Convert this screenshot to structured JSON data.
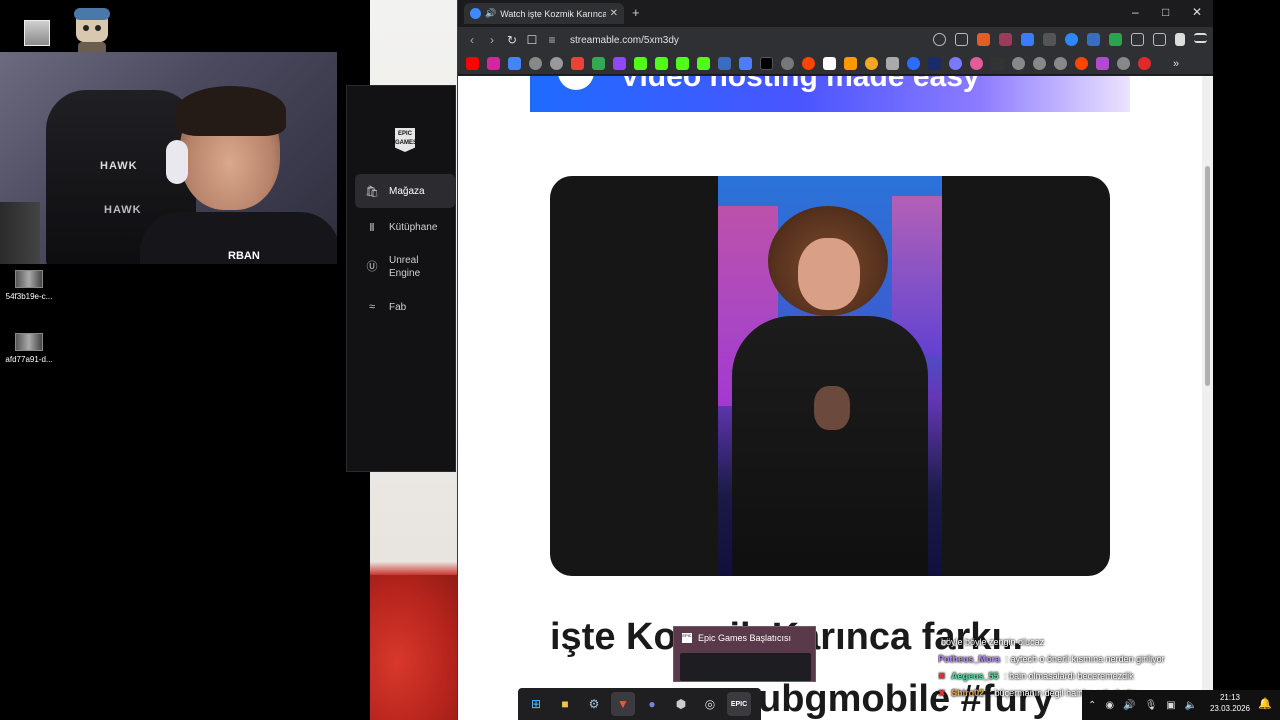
{
  "desktop": {
    "icons": [
      {
        "label": "54f3b19e-c..."
      },
      {
        "label": "afd77a91-d..."
      }
    ]
  },
  "webcam": {
    "chair_brand": "HAWK",
    "shirt_text": "RBAN"
  },
  "epic_launcher": {
    "logo_text": "EPIC GAMES",
    "nav": [
      {
        "label": "Mağaza",
        "icon": "bag-icon",
        "active": true
      },
      {
        "label": "Kütüphane",
        "icon": "library-icon",
        "active": false
      },
      {
        "label": "Unreal\nEngine",
        "icon": "unreal-icon",
        "active": false
      },
      {
        "label": "Fab",
        "icon": "fab-icon",
        "active": false
      }
    ]
  },
  "browser": {
    "tab_title": "Watch işte Kozmik Karınca fa",
    "url": "streamable.com/5xm3dy",
    "banner_text": "Video hosting made easy",
    "headline_line1": "işte Kozmik Karınca farkı..",
    "headline_line2": "ubgmobile #fury",
    "accent": "#3d6bff"
  },
  "taskbar_preview": {
    "title": "Epic Games Başlatıcısı"
  },
  "chat": [
    {
      "user": "",
      "user_color": "#6dff5a",
      "text": "böyle böyle zengin olucaz"
    },
    {
      "user": "Potheus_Mora",
      "user_color": "#b58bff",
      "text": ": aytech o önerli kısmına nerden giriliyor"
    },
    {
      "user": "Aegeus_55",
      "user_color": "#4fe0a0",
      "text": ": bain olmasalardı beceremezdik"
    },
    {
      "user": "Shiro02",
      "user_color": "#e0a84f",
      "text": ": büçermanın degil hainler çok chatte"
    }
  ],
  "clock": {
    "time": "21:13",
    "date": "23.03.2026"
  }
}
